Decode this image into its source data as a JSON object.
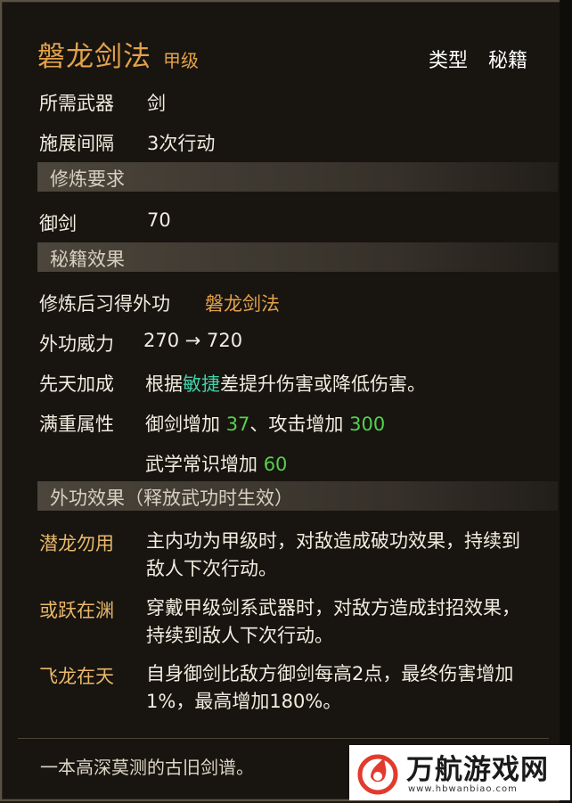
{
  "header": {
    "name": "磐龙剑法",
    "grade": "甲级",
    "type_label": "类型",
    "type_value": "秘籍"
  },
  "stats": {
    "weapon_label": "所需武器",
    "weapon_value": "剑",
    "interval_label": "施展间隔",
    "interval_value": "3次行动"
  },
  "requirements": {
    "section_title": "修炼要求",
    "skill_label": "御剑",
    "skill_value": "70"
  },
  "book_effects": {
    "section_title": "秘籍效果",
    "learn_label": "修炼后习得外功",
    "learn_value": "磐龙剑法",
    "power_label": "外功威力",
    "power_value": "270 → 720",
    "innate_label": "先天加成",
    "innate_pre": "根据",
    "innate_attr": "敏捷",
    "innate_post": "差提升伤害或降低伤害。",
    "full_label": "满重属性",
    "full_line1_a": "御剑增加 ",
    "full_line1_b": "37",
    "full_line1_c": "、攻击增加 ",
    "full_line1_d": "300",
    "full_line2_a": "武学常识增加 ",
    "full_line2_b": "60"
  },
  "skill_effects": {
    "section_title": "外功效果（释放武功时生效）",
    "items": [
      {
        "name": "潜龙勿用",
        "line1": "主内功为甲级时，对敌造成破功效果，持续到",
        "line2": "敌人下次行动。"
      },
      {
        "name": "或跃在渊",
        "line1": "穿戴甲级剑系武器时，对敌方造成封招效果，",
        "line2": "持续到敌人下次行动。"
      },
      {
        "name": "飞龙在天",
        "line1": "自身御剑比敌方御剑每高2点，最终伤害增加",
        "line2": "1%，最高增加180%。"
      }
    ]
  },
  "description": "一本高深莫测的古旧剑谱。",
  "watermark": {
    "title": "万航游戏网",
    "url": "www.hbwanbiao.com"
  },
  "colors": {
    "title": "#e3a24a",
    "effect_name": "#e8b86a",
    "number_green": "#55d04e",
    "attr_teal": "#3fd0a8"
  }
}
